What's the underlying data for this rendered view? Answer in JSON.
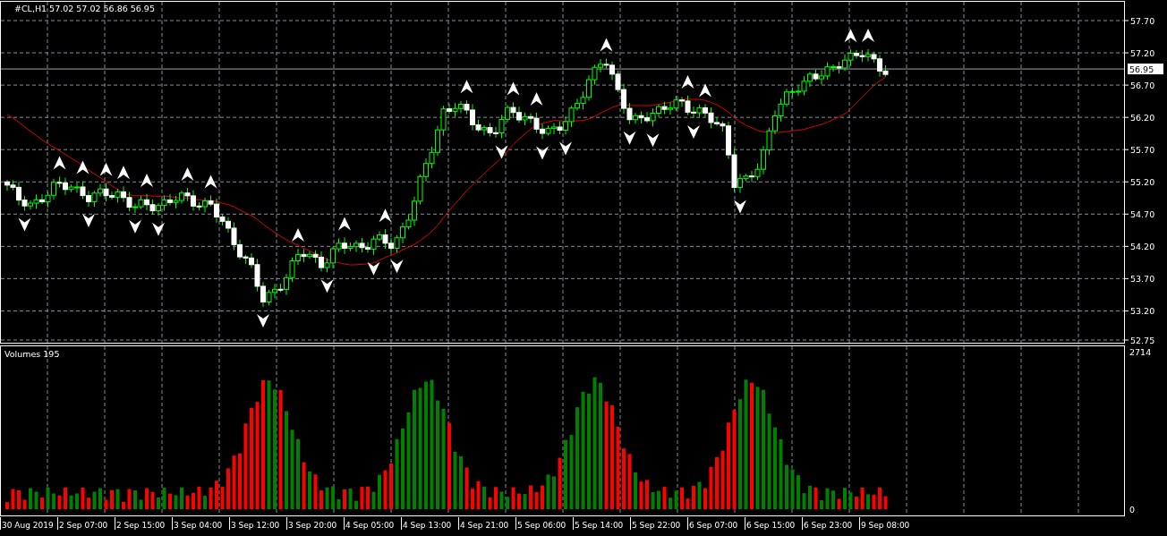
{
  "chart": {
    "title": "#CL,H1  57.02 57.02 56.86 56.95",
    "current_price": "56.95",
    "price_ticks": [
      "57.70",
      "57.20",
      "56.70",
      "56.20",
      "55.70",
      "55.20",
      "54.70",
      "54.20",
      "53.70",
      "53.20",
      "52.75"
    ]
  },
  "volume_panel": {
    "title": "Volumes 195",
    "max_label": "2714",
    "min_label": "0"
  },
  "time_axis": {
    "labels": [
      "30 Aug 2019",
      "2 Sep 07:00",
      "2 Sep 15:00",
      "3 Sep 04:00",
      "3 Sep 12:00",
      "3 Sep 20:00",
      "4 Sep 05:00",
      "4 Sep 13:00",
      "4 Sep 21:00",
      "5 Sep 06:00",
      "5 Sep 14:00",
      "5 Sep 22:00",
      "6 Sep 07:00",
      "6 Sep 15:00",
      "6 Sep 23:00",
      "9 Sep 08:00"
    ]
  }
}
